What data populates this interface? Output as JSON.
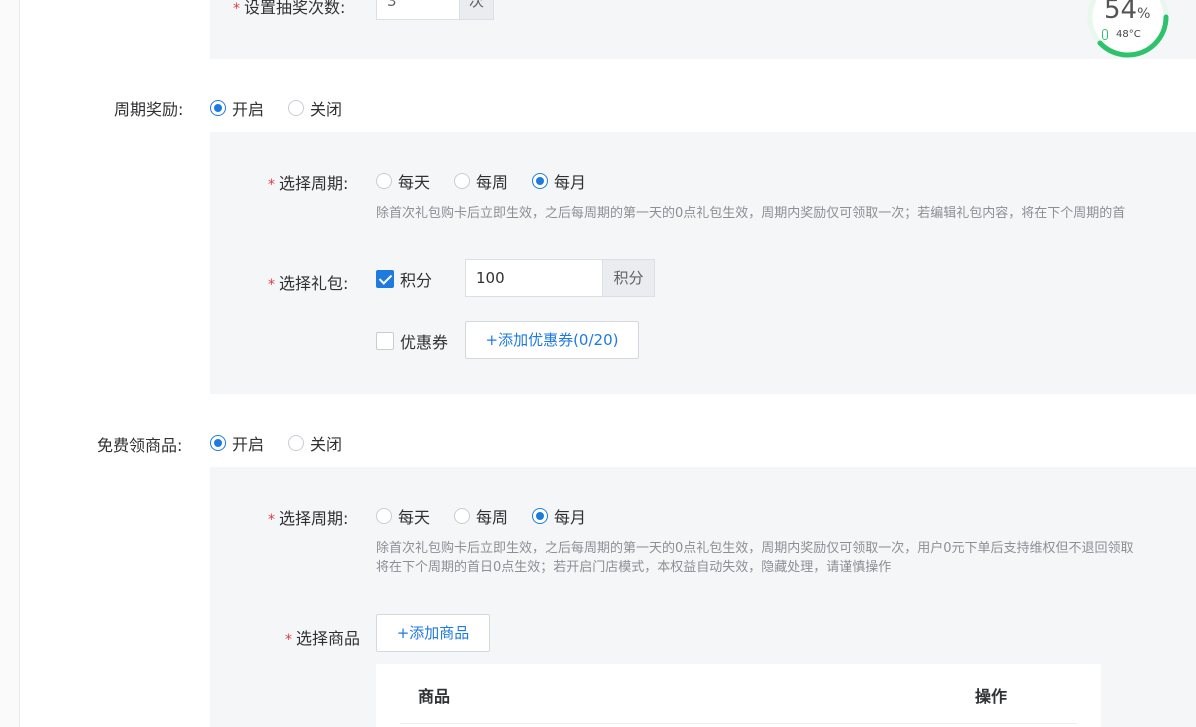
{
  "lottery": {
    "label": "设置抽奖次数:",
    "value": "3",
    "suffix": "次"
  },
  "system_monitor": {
    "percent": "54",
    "percent_unit": "%",
    "temperature": "48°C",
    "ring_color": "#2ec36b"
  },
  "cycle_reward": {
    "label": "周期奖励:",
    "options": [
      "开启",
      "关闭"
    ],
    "selected": "开启",
    "period": {
      "label": "选择周期:",
      "options": [
        "每天",
        "每周",
        "每月"
      ],
      "selected": "每月",
      "hint": "除首次礼包购卡后立即生效，之后每周期的第一天的0点礼包生效，周期内奖励仅可领取一次；若编辑礼包内容，将在下个周期的首"
    },
    "gift": {
      "label": "选择礼包:",
      "points_label": "积分",
      "points_checked": true,
      "points_value": "100",
      "points_suffix": "积分",
      "coupon_label": "优惠券",
      "coupon_checked": false,
      "add_coupon_button": "+添加优惠券(0/20)"
    }
  },
  "free_goods": {
    "label": "免费领商品:",
    "options": [
      "开启",
      "关闭"
    ],
    "selected": "开启",
    "period": {
      "label": "选择周期:",
      "options": [
        "每天",
        "每周",
        "每月"
      ],
      "selected": "每月",
      "hint_line1": "除首次礼包购卡后立即生效，之后每周期的第一天的0点礼包生效，周期内奖励仅可领取一次，用户0元下单后支持维权但不退回领取",
      "hint_line2": "将在下个周期的首日0点生效；若开启门店模式，本权益自动失效，隐藏处理，请谨慎操作"
    },
    "goods": {
      "label": "选择商品",
      "add_button": "+添加商品",
      "columns": [
        "商品",
        "操作"
      ]
    }
  },
  "colors": {
    "accent": "#1f7ae0",
    "required": "#e4393c",
    "panel_bg": "#f5f6f7",
    "hint": "#8b8f96"
  }
}
